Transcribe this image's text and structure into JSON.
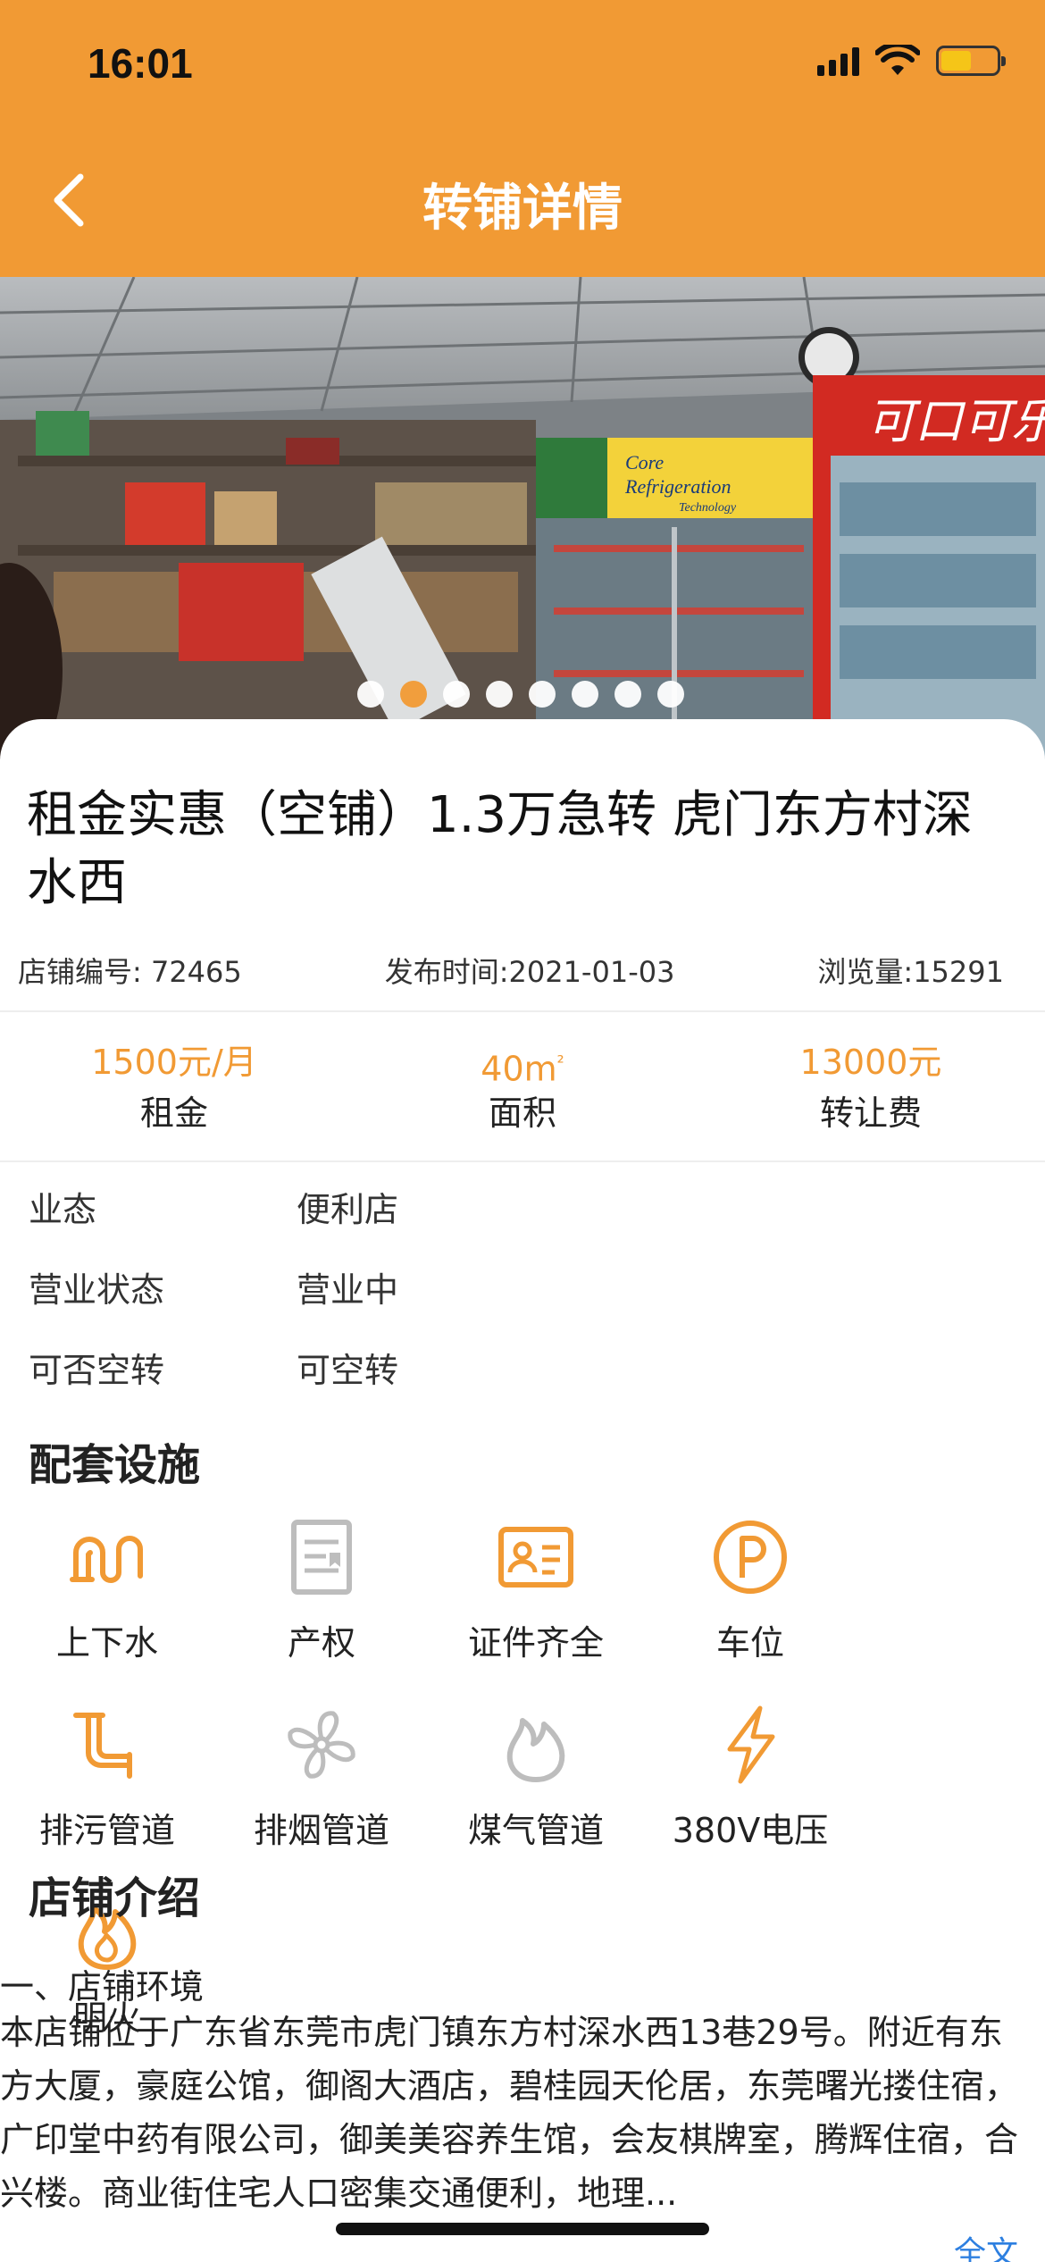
{
  "status_bar": {
    "time": "16:01"
  },
  "nav": {
    "title": "转铺详情"
  },
  "carousel": {
    "total": 8,
    "active_index": 1,
    "sign_text": "可口可乐",
    "fridge_text": "Core Refrigeration Technology"
  },
  "shop": {
    "title": "租金实惠（空铺）1.3万急转 虎门东方村深水西",
    "id_label": "店铺编号: 72465",
    "publish_label": "发布时间:2021-01-03",
    "views_label": "浏览量:15291"
  },
  "stats": [
    {
      "value": "1500元/月",
      "label": "租金"
    },
    {
      "value": "40m",
      "value_sup": "²",
      "label": "面积"
    },
    {
      "value": "13000元",
      "label": "转让费"
    }
  ],
  "attributes": [
    {
      "key": "业态",
      "value": "便利店"
    },
    {
      "key": "营业状态",
      "value": "营业中"
    },
    {
      "key": "可否空转",
      "value": "可空转"
    }
  ],
  "facilities_title": "配套设施",
  "facilities": [
    {
      "icon": "water-pipe-icon",
      "label": "上下水",
      "available": true
    },
    {
      "icon": "property-certificate-icon",
      "label": "产权",
      "available": false
    },
    {
      "icon": "id-card-icon",
      "label": "证件齐全",
      "available": true
    },
    {
      "icon": "parking-icon",
      "label": "车位",
      "available": true
    },
    {
      "icon": "sewage-pipe-icon",
      "label": "排污管道",
      "available": true
    },
    {
      "icon": "exhaust-fan-icon",
      "label": "排烟管道",
      "available": false
    },
    {
      "icon": "gas-flame-icon",
      "label": "煤气管道",
      "available": false
    },
    {
      "icon": "lightning-icon",
      "label": "380V电压",
      "available": true
    },
    {
      "icon": "open-fire-icon",
      "label": "明火",
      "available": true
    }
  ],
  "intro": {
    "title": "店铺介绍",
    "heading": "一、店铺环境",
    "body": "本店铺位于广东省东莞市虎门镇东方村深水西13巷29号。附近有东方大厦，豪庭公馆，御阁大酒店，碧桂园天伦居，东莞曙光搂住宿，广印堂中药有限公司，御美美容养生馆，会友棋牌室，腾辉住宿，合兴楼。商业街住宅人口密集交通便利，地理...",
    "read_more": "全文"
  },
  "colors": {
    "accent": "#F19A34",
    "inactive_icon": "#BDBDBD",
    "link": "#2D7FE0"
  }
}
